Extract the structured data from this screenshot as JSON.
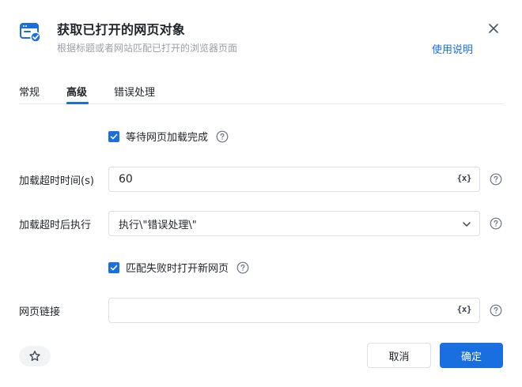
{
  "header": {
    "icon": "browser-window-check-icon",
    "title": "获取已打开的网页对象",
    "subtitle": "根据标题或者网站匹配已打开的浏览器页面",
    "help_link": "使用说明",
    "close_icon": "close-icon"
  },
  "tabs": [
    {
      "label": "常规",
      "active": false
    },
    {
      "label": "高级",
      "active": true
    },
    {
      "label": "错误处理",
      "active": false
    }
  ],
  "form": {
    "wait_load": {
      "label": "等待网页加载完成",
      "checked": true
    },
    "load_timeout": {
      "label": "加载超时时间(s)",
      "value": "60",
      "var_label": "{x}"
    },
    "timeout_action": {
      "label": "加载超时后执行",
      "value": "执行\\\"错误处理\\\""
    },
    "open_new_on_fail": {
      "label": "匹配失败时打开新网页",
      "checked": true
    },
    "page_url": {
      "label": "网页链接",
      "value": "",
      "var_label": "{x}"
    }
  },
  "footer": {
    "favorite_icon": "star-icon",
    "cancel_label": "取消",
    "ok_label": "确定"
  },
  "colors": {
    "accent": "#1a6fe0",
    "text": "#1f2329",
    "muted": "#9aa0a8",
    "border": "#dcdfe4"
  }
}
